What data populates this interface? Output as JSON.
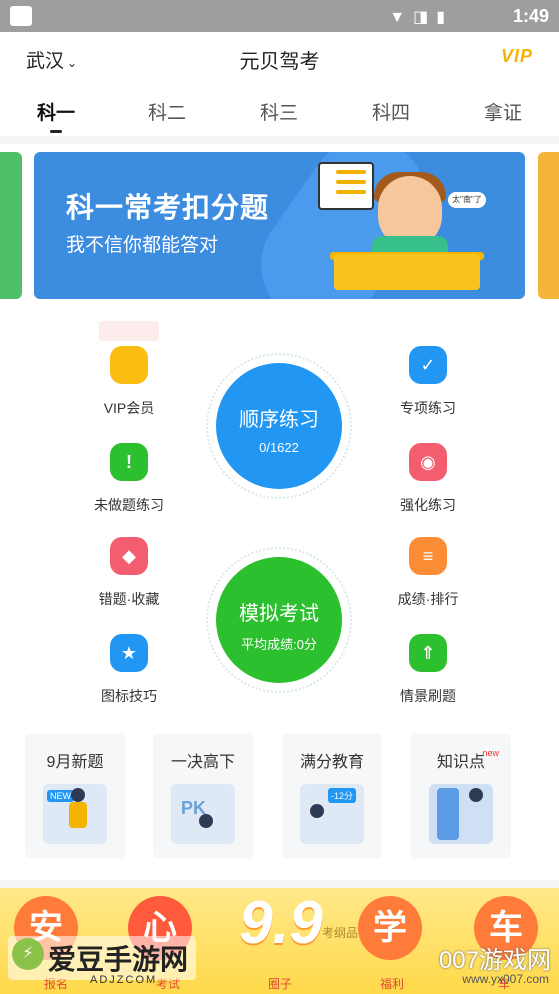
{
  "status_bar": {
    "time": "1:49"
  },
  "header": {
    "city": "武汉",
    "title": "元贝驾考",
    "vip": "VIP"
  },
  "tabs": [
    "科一",
    "科二",
    "科三",
    "科四",
    "拿证"
  ],
  "active_tab": "科一",
  "banner": {
    "title": "科一常考扣分题",
    "subtitle": "我不信你都能答对",
    "bubble": "太\"南\"了"
  },
  "practice": {
    "order": {
      "title": "顺序练习",
      "progress": "0/1622"
    },
    "mock": {
      "title": "模拟考试",
      "avg": "平均成绩:0分"
    }
  },
  "features": {
    "vip": "VIP会员",
    "special": "专项练习",
    "undone": "未做题练习",
    "strengthen": "强化练习",
    "wrong": "错题·收藏",
    "score": "成绩·排行",
    "icon_tips": "图标技巧",
    "scene": "情景刷题"
  },
  "colors": {
    "blue": "#2196f3",
    "green": "#2cbf2e",
    "yellow": "#fcbc11",
    "red": "#f25757",
    "orange": "#fd8c37",
    "pink": "#f25d6f"
  },
  "cards": [
    {
      "title": "9月新题",
      "art": "NEW",
      "new": ""
    },
    {
      "title": "一决高下",
      "art": "PK",
      "new": ""
    },
    {
      "title": "满分教育",
      "art": "-12分",
      "new": ""
    },
    {
      "title": "知识点",
      "art": "",
      "new": "new"
    }
  ],
  "bottom": {
    "chars": [
      "安",
      "心",
      "学",
      "车"
    ],
    "big": "9.9",
    "labels": [
      "报名",
      "考试",
      "圈子",
      "福利",
      "车"
    ],
    "note": "考纲品"
  },
  "watermark": {
    "left": "爱豆手游网",
    "left_sub": "ADJZCOM",
    "right": "007游戏网",
    "right_sub": "www.yx007.com"
  }
}
